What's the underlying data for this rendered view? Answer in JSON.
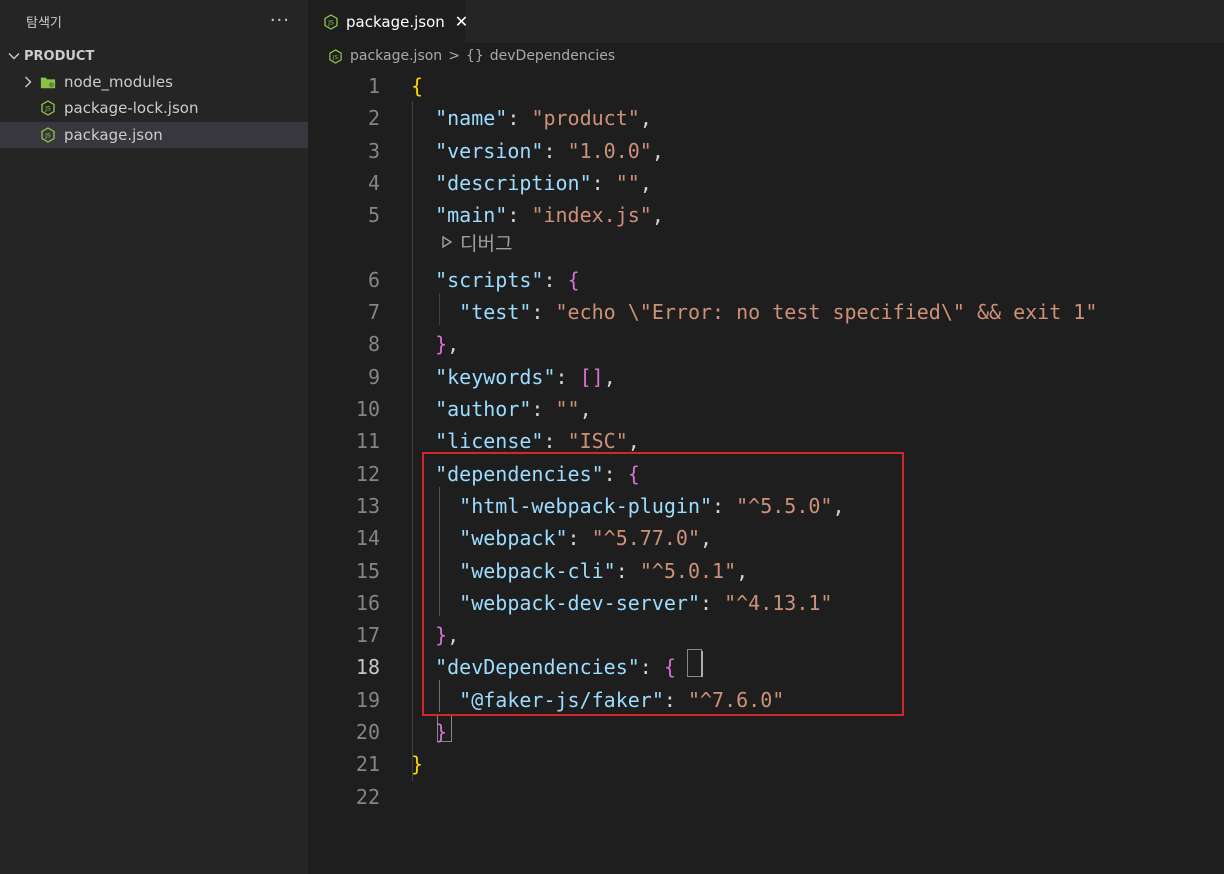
{
  "sidebar": {
    "title": "탐색기",
    "more": "···",
    "folder": "PRODUCT",
    "items": [
      {
        "label": "node_modules",
        "icon": "folder-icon"
      },
      {
        "label": "package-lock.json",
        "icon": "nodejs-icon"
      },
      {
        "label": "package.json",
        "icon": "nodejs-icon",
        "selected": true
      }
    ]
  },
  "tab": {
    "label": "package.json",
    "close": "✕"
  },
  "breadcrumb": {
    "file": "package.json",
    "separator": ">",
    "braces": "{}",
    "symbol": "devDependencies"
  },
  "editor": {
    "codelens": "디버그",
    "active_line": 18,
    "lines": [
      {
        "n": "1",
        "tokens": [
          {
            "t": "{",
            "c": "b1"
          }
        ]
      },
      {
        "n": "2",
        "tokens": [
          {
            "t": "  "
          },
          {
            "t": "\"name\"",
            "c": "k"
          },
          {
            "t": ": ",
            "c": "p"
          },
          {
            "t": "\"product\"",
            "c": "s"
          },
          {
            "t": ",",
            "c": "p"
          }
        ]
      },
      {
        "n": "3",
        "tokens": [
          {
            "t": "  "
          },
          {
            "t": "\"version\"",
            "c": "k"
          },
          {
            "t": ": ",
            "c": "p"
          },
          {
            "t": "\"1.0.0\"",
            "c": "s"
          },
          {
            "t": ",",
            "c": "p"
          }
        ]
      },
      {
        "n": "4",
        "tokens": [
          {
            "t": "  "
          },
          {
            "t": "\"description\"",
            "c": "k"
          },
          {
            "t": ": ",
            "c": "p"
          },
          {
            "t": "\"\"",
            "c": "s"
          },
          {
            "t": ",",
            "c": "p"
          }
        ]
      },
      {
        "n": "5",
        "tokens": [
          {
            "t": "  "
          },
          {
            "t": "\"main\"",
            "c": "k"
          },
          {
            "t": ": ",
            "c": "p"
          },
          {
            "t": "\"index.js\"",
            "c": "s"
          },
          {
            "t": ",",
            "c": "p"
          }
        ]
      },
      {
        "n": "6",
        "tokens": [
          {
            "t": "  "
          },
          {
            "t": "\"scripts\"",
            "c": "k"
          },
          {
            "t": ": ",
            "c": "p"
          },
          {
            "t": "{",
            "c": "b2"
          }
        ]
      },
      {
        "n": "7",
        "tokens": [
          {
            "t": "    "
          },
          {
            "t": "\"test\"",
            "c": "k"
          },
          {
            "t": ": ",
            "c": "p"
          },
          {
            "t": "\"echo \\\"Error: no test specified\\\" && exit 1\"",
            "c": "s"
          }
        ]
      },
      {
        "n": "8",
        "tokens": [
          {
            "t": "  "
          },
          {
            "t": "}",
            "c": "b2"
          },
          {
            "t": ",",
            "c": "p"
          }
        ]
      },
      {
        "n": "9",
        "tokens": [
          {
            "t": "  "
          },
          {
            "t": "\"keywords\"",
            "c": "k"
          },
          {
            "t": ": ",
            "c": "p"
          },
          {
            "t": "[]",
            "c": "b2"
          },
          {
            "t": ",",
            "c": "p"
          }
        ]
      },
      {
        "n": "10",
        "tokens": [
          {
            "t": "  "
          },
          {
            "t": "\"author\"",
            "c": "k"
          },
          {
            "t": ": ",
            "c": "p"
          },
          {
            "t": "\"\"",
            "c": "s"
          },
          {
            "t": ",",
            "c": "p"
          }
        ]
      },
      {
        "n": "11",
        "tokens": [
          {
            "t": "  "
          },
          {
            "t": "\"license\"",
            "c": "k"
          },
          {
            "t": ": ",
            "c": "p"
          },
          {
            "t": "\"ISC\"",
            "c": "s"
          },
          {
            "t": ",",
            "c": "p"
          }
        ]
      },
      {
        "n": "12",
        "tokens": [
          {
            "t": "  "
          },
          {
            "t": "\"dependencies\"",
            "c": "k"
          },
          {
            "t": ": ",
            "c": "p"
          },
          {
            "t": "{",
            "c": "b2"
          }
        ]
      },
      {
        "n": "13",
        "tokens": [
          {
            "t": "    "
          },
          {
            "t": "\"html-webpack-plugin\"",
            "c": "k"
          },
          {
            "t": ": ",
            "c": "p"
          },
          {
            "t": "\"^5.5.0\"",
            "c": "s"
          },
          {
            "t": ",",
            "c": "p"
          }
        ]
      },
      {
        "n": "14",
        "tokens": [
          {
            "t": "    "
          },
          {
            "t": "\"webpack\"",
            "c": "k"
          },
          {
            "t": ": ",
            "c": "p"
          },
          {
            "t": "\"^5.77.0\"",
            "c": "s"
          },
          {
            "t": ",",
            "c": "p"
          }
        ]
      },
      {
        "n": "15",
        "tokens": [
          {
            "t": "    "
          },
          {
            "t": "\"webpack-cli\"",
            "c": "k"
          },
          {
            "t": ": ",
            "c": "p"
          },
          {
            "t": "\"^5.0.1\"",
            "c": "s"
          },
          {
            "t": ",",
            "c": "p"
          }
        ]
      },
      {
        "n": "16",
        "tokens": [
          {
            "t": "    "
          },
          {
            "t": "\"webpack-dev-server\"",
            "c": "k"
          },
          {
            "t": ": ",
            "c": "p"
          },
          {
            "t": "\"^4.13.1\"",
            "c": "s"
          }
        ]
      },
      {
        "n": "17",
        "tokens": [
          {
            "t": "  "
          },
          {
            "t": "}",
            "c": "b2"
          },
          {
            "t": ",",
            "c": "p"
          }
        ]
      },
      {
        "n": "18",
        "tokens": [
          {
            "t": "  "
          },
          {
            "t": "\"devDependencies\"",
            "c": "k"
          },
          {
            "t": ": ",
            "c": "p"
          },
          {
            "t": "{",
            "c": "b2"
          }
        ]
      },
      {
        "n": "19",
        "tokens": [
          {
            "t": "    "
          },
          {
            "t": "\"@faker-js/faker\"",
            "c": "k"
          },
          {
            "t": ": ",
            "c": "p"
          },
          {
            "t": "\"^7.6.0\"",
            "c": "s"
          }
        ]
      },
      {
        "n": "20",
        "tokens": [
          {
            "t": "  "
          },
          {
            "t": "}",
            "c": "b2"
          }
        ]
      },
      {
        "n": "21",
        "tokens": [
          {
            "t": "}",
            "c": "b1"
          }
        ]
      },
      {
        "n": "22",
        "tokens": []
      }
    ]
  },
  "colors": {
    "background": "#1e1e1e",
    "sidebar": "#252526",
    "key": "#9cdcfe",
    "string": "#ce9178",
    "highlight_box": "#d2272a",
    "node_icon": "#8cc84b"
  }
}
